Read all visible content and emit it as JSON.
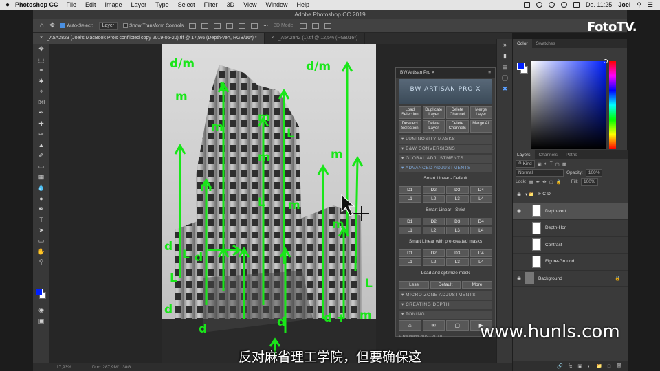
{
  "menubar": {
    "app_name": "Photoshop CC",
    "items": [
      "File",
      "Edit",
      "Image",
      "Layer",
      "Type",
      "Select",
      "Filter",
      "3D",
      "View",
      "Window",
      "Help"
    ],
    "clock": "Do. 11:25",
    "user": "Joel"
  },
  "window": {
    "title": "Adobe Photoshop CC 2019"
  },
  "options": {
    "auto_select_label": "Auto-Select:",
    "auto_select_value": "Layer",
    "transform_label": "Show Transform Controls",
    "mode_label": "3D Mode:"
  },
  "tabs": [
    {
      "label": "_A5A2823 (Joel's MacBook Pro's conflicted copy 2019-06-20).tif @ 17,9% (Depth-vert, RGB/16*) *"
    },
    {
      "label": "_A5A2842 (1).tif @ 12,5% (RGB/16*)"
    }
  ],
  "status": {
    "zoom": "17,93%",
    "doc": "Doc: 287,9M/1,38G"
  },
  "bw_panel": {
    "title": "BW Artisan Pro X",
    "logo": "BW ARTISAN PRO X",
    "top_buttons": [
      "Load Selection",
      "Duplicate Layer",
      "Delete Channel",
      "Merge Layer",
      "Deselect Selection",
      "Delete Layer",
      "Delete Channels",
      "Merge All"
    ],
    "sections": {
      "luminosity": "LUMINOSITY MASKS",
      "bw": "B&W CONVERSIONS",
      "global": "GLOBAL ADJUSTMENTS",
      "advanced": "ADVANCED ADJUSTMENTS",
      "micro": "MICRO ZONE ADJUSTMENTS",
      "depth": "CREATING DEPTH",
      "toning": "TONING"
    },
    "smart_default": "Smart Linear - Default",
    "smart_strict": "Smart Linear - Strict",
    "smart_precreated": "Smart Linear with pre-created masks",
    "load_optimize": "Load and optimize mask",
    "d_buttons": [
      "D1",
      "D2",
      "D3",
      "D4"
    ],
    "l_buttons": [
      "L1",
      "L2",
      "L3",
      "L4"
    ],
    "mask_buttons": [
      "Less",
      "Default",
      "More"
    ],
    "footer": "© BWVision 2019 - v1.0.0"
  },
  "color_panel": {
    "tabs": [
      "Color",
      "Swatches"
    ],
    "foreground": "#0020ff",
    "background": "#ffffff"
  },
  "layers_panel": {
    "tabs": [
      "Layers",
      "Channels",
      "Paths"
    ],
    "kind": "Kind",
    "blend_mode": "Normal",
    "opacity_label": "Opacity:",
    "opacity_value": "100%",
    "lock_label": "Lock:",
    "fill_label": "Fill:",
    "fill_value": "100%",
    "group": "F-C-D",
    "layers": [
      "Depth-vert",
      "Depth-Hor",
      "Contrast",
      "Figure-Ground",
      "Background"
    ]
  },
  "annotations": {
    "labels": [
      "d/m",
      "d/m",
      "m",
      "L",
      "m",
      "m",
      "L",
      "m",
      "m",
      "L",
      "L",
      "d",
      "L",
      "m",
      "m",
      "m",
      "L",
      "d",
      "d",
      "d",
      "d",
      "+",
      "m",
      "d"
    ]
  },
  "overlay": {
    "channel_logo": "FotoTV.",
    "watermark": "www.hunls.com",
    "subtitle": "反对麻省理工学院，但要确保这"
  }
}
